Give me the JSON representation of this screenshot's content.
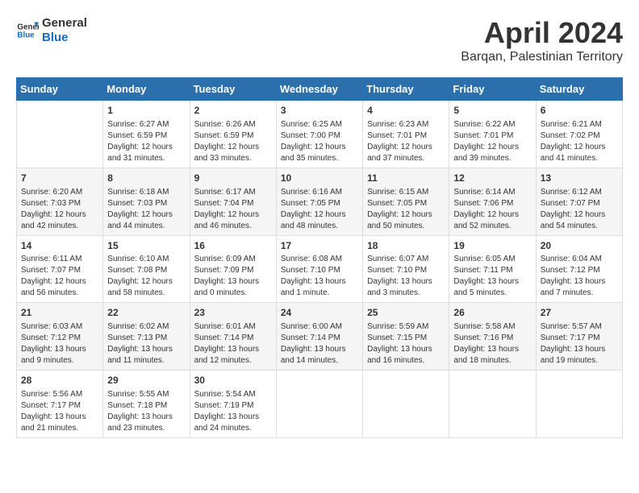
{
  "logo": {
    "line1": "General",
    "line2": "Blue"
  },
  "title": "April 2024",
  "location": "Barqan, Palestinian Territory",
  "headers": [
    "Sunday",
    "Monday",
    "Tuesday",
    "Wednesday",
    "Thursday",
    "Friday",
    "Saturday"
  ],
  "weeks": [
    [
      {
        "day": "",
        "info": ""
      },
      {
        "day": "1",
        "info": "Sunrise: 6:27 AM\nSunset: 6:59 PM\nDaylight: 12 hours\nand 31 minutes."
      },
      {
        "day": "2",
        "info": "Sunrise: 6:26 AM\nSunset: 6:59 PM\nDaylight: 12 hours\nand 33 minutes."
      },
      {
        "day": "3",
        "info": "Sunrise: 6:25 AM\nSunset: 7:00 PM\nDaylight: 12 hours\nand 35 minutes."
      },
      {
        "day": "4",
        "info": "Sunrise: 6:23 AM\nSunset: 7:01 PM\nDaylight: 12 hours\nand 37 minutes."
      },
      {
        "day": "5",
        "info": "Sunrise: 6:22 AM\nSunset: 7:01 PM\nDaylight: 12 hours\nand 39 minutes."
      },
      {
        "day": "6",
        "info": "Sunrise: 6:21 AM\nSunset: 7:02 PM\nDaylight: 12 hours\nand 41 minutes."
      }
    ],
    [
      {
        "day": "7",
        "info": "Sunrise: 6:20 AM\nSunset: 7:03 PM\nDaylight: 12 hours\nand 42 minutes."
      },
      {
        "day": "8",
        "info": "Sunrise: 6:18 AM\nSunset: 7:03 PM\nDaylight: 12 hours\nand 44 minutes."
      },
      {
        "day": "9",
        "info": "Sunrise: 6:17 AM\nSunset: 7:04 PM\nDaylight: 12 hours\nand 46 minutes."
      },
      {
        "day": "10",
        "info": "Sunrise: 6:16 AM\nSunset: 7:05 PM\nDaylight: 12 hours\nand 48 minutes."
      },
      {
        "day": "11",
        "info": "Sunrise: 6:15 AM\nSunset: 7:05 PM\nDaylight: 12 hours\nand 50 minutes."
      },
      {
        "day": "12",
        "info": "Sunrise: 6:14 AM\nSunset: 7:06 PM\nDaylight: 12 hours\nand 52 minutes."
      },
      {
        "day": "13",
        "info": "Sunrise: 6:12 AM\nSunset: 7:07 PM\nDaylight: 12 hours\nand 54 minutes."
      }
    ],
    [
      {
        "day": "14",
        "info": "Sunrise: 6:11 AM\nSunset: 7:07 PM\nDaylight: 12 hours\nand 56 minutes."
      },
      {
        "day": "15",
        "info": "Sunrise: 6:10 AM\nSunset: 7:08 PM\nDaylight: 12 hours\nand 58 minutes."
      },
      {
        "day": "16",
        "info": "Sunrise: 6:09 AM\nSunset: 7:09 PM\nDaylight: 13 hours\nand 0 minutes."
      },
      {
        "day": "17",
        "info": "Sunrise: 6:08 AM\nSunset: 7:10 PM\nDaylight: 13 hours\nand 1 minute."
      },
      {
        "day": "18",
        "info": "Sunrise: 6:07 AM\nSunset: 7:10 PM\nDaylight: 13 hours\nand 3 minutes."
      },
      {
        "day": "19",
        "info": "Sunrise: 6:05 AM\nSunset: 7:11 PM\nDaylight: 13 hours\nand 5 minutes."
      },
      {
        "day": "20",
        "info": "Sunrise: 6:04 AM\nSunset: 7:12 PM\nDaylight: 13 hours\nand 7 minutes."
      }
    ],
    [
      {
        "day": "21",
        "info": "Sunrise: 6:03 AM\nSunset: 7:12 PM\nDaylight: 13 hours\nand 9 minutes."
      },
      {
        "day": "22",
        "info": "Sunrise: 6:02 AM\nSunset: 7:13 PM\nDaylight: 13 hours\nand 11 minutes."
      },
      {
        "day": "23",
        "info": "Sunrise: 6:01 AM\nSunset: 7:14 PM\nDaylight: 13 hours\nand 12 minutes."
      },
      {
        "day": "24",
        "info": "Sunrise: 6:00 AM\nSunset: 7:14 PM\nDaylight: 13 hours\nand 14 minutes."
      },
      {
        "day": "25",
        "info": "Sunrise: 5:59 AM\nSunset: 7:15 PM\nDaylight: 13 hours\nand 16 minutes."
      },
      {
        "day": "26",
        "info": "Sunrise: 5:58 AM\nSunset: 7:16 PM\nDaylight: 13 hours\nand 18 minutes."
      },
      {
        "day": "27",
        "info": "Sunrise: 5:57 AM\nSunset: 7:17 PM\nDaylight: 13 hours\nand 19 minutes."
      }
    ],
    [
      {
        "day": "28",
        "info": "Sunrise: 5:56 AM\nSunset: 7:17 PM\nDaylight: 13 hours\nand 21 minutes."
      },
      {
        "day": "29",
        "info": "Sunrise: 5:55 AM\nSunset: 7:18 PM\nDaylight: 13 hours\nand 23 minutes."
      },
      {
        "day": "30",
        "info": "Sunrise: 5:54 AM\nSunset: 7:19 PM\nDaylight: 13 hours\nand 24 minutes."
      },
      {
        "day": "",
        "info": ""
      },
      {
        "day": "",
        "info": ""
      },
      {
        "day": "",
        "info": ""
      },
      {
        "day": "",
        "info": ""
      }
    ]
  ]
}
